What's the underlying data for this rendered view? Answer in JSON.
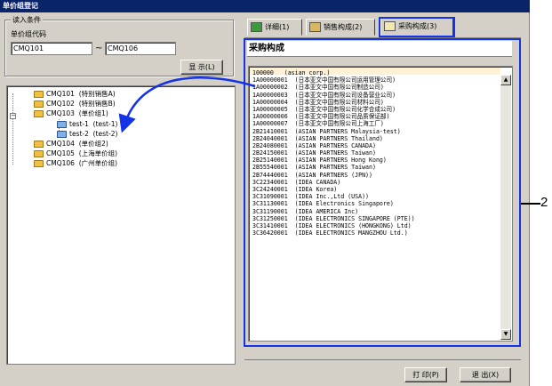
{
  "window": {
    "title": "单价组登记"
  },
  "filter": {
    "group_label": "读入条件",
    "code_label": "单价组代码",
    "code_from": "CMQ101",
    "code_to": "CMQ106",
    "range_separator": "~",
    "show_button": "显 示(L)"
  },
  "tree": {
    "expand_symbol": "−",
    "nodes": [
      {
        "code": "CMQ101",
        "name": "(特别销售A)"
      },
      {
        "code": "CMQ102",
        "name": "(特别销售B)"
      },
      {
        "code": "CMQ103",
        "name": "(单价组1)"
      },
      {
        "code": "test-1",
        "name": "(test-1)"
      },
      {
        "code": "test-2",
        "name": "(test-2)"
      },
      {
        "code": "CMQ104",
        "name": "(单价组2)"
      },
      {
        "code": "CMQ105",
        "name": "(上海单价组)"
      },
      {
        "code": "CMQ106",
        "name": "(广州单价组)"
      }
    ]
  },
  "tabs": [
    {
      "label": "详细(1)"
    },
    {
      "label": "销售构成(2)"
    },
    {
      "label": "采购构成(3)"
    }
  ],
  "panel": {
    "title": "采购构成",
    "scroll_up": "▲",
    "scroll_down": "▼",
    "rows": [
      "100000   (asian corp.)",
      "1A00000001  (日本亚文中国有限公司运用管理公司)",
      "1A00000002  (日本亚文中国有限公司制造公司)",
      "1A00000003  (日本亚文中国有限公司设备营业公司)",
      "1A00000004  (日本亚文中国有限公司材料公司)",
      "1A00000005  (日本亚文中国有限公司化学合成公司)",
      "1A00000006  (日本亚文中国有限公司品质保证部)",
      "1A00000007  (日本亚文中国有限公司上海工厂)",
      "2B21410001  (ASIAN PARTNERS Malaysia-test)",
      "2B24040001  (ASIAN PARTNERS Thailand)",
      "2B24080001  (ASIAN PARTNERS CANADA)",
      "2B24150001  (ASIAN PARTNERS Taiwan)",
      "2B25140001  (ASIAN PARTNERS Hong Kong)",
      "2B55540001  (ASIAN PARTNERS Taiwan)",
      "2B74440001  (ASIAN PARTNERS (JPN))",
      "3C22340001  (IDEA CANADA)",
      "3C24240001  (IDEA Korea)",
      "3C31090001  (IDEA Inc.,Ltd (USA))",
      "3C31130001  (IDEA Electronics Singapore)",
      "3C31190001  (IDEA AMERICA Inc)",
      "3C31250001  (IDEA ELECTRONICS SINGAPORE (PTE))",
      "3C31410001  (IDEA ELECTRONICS (HONGKONG) Ltd)",
      "3C36420001  (IDEA ELECTRONICS MANGZHOU Ltd.)"
    ]
  },
  "footer": {
    "print_button": "打 印(P)",
    "exit_button": "退 出(X)"
  },
  "annotation": {
    "callout_number": "2"
  },
  "colors": {
    "titlebar": "#0a246a",
    "highlight": "#1432e6",
    "arrow": "#1432e6"
  }
}
